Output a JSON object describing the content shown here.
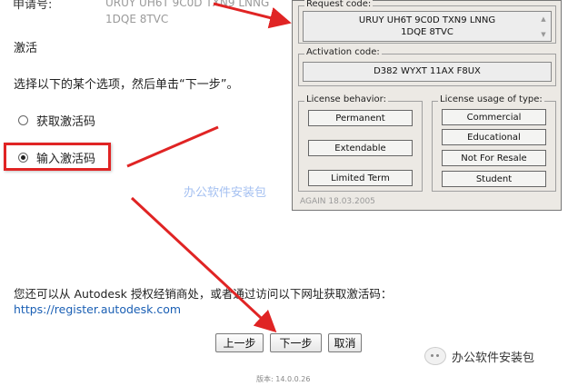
{
  "installer": {
    "request_label": "申请号:",
    "request_value_line1": "URUY UH6T 9C0D TXN9 LNNG",
    "request_value_line2": "1DQE 8TVC",
    "section_title": "激活",
    "instruction": "选择以下的某个选项，然后单击“下一步”。",
    "option_get_code": "获取激活码",
    "option_enter_code": "输入激活码",
    "footer_text": "您还可以从 Autodesk 授权经销商处，或者通过访问以下网址获取激活码：",
    "footer_link": "https://register.autodesk.com",
    "back_button": "上一步",
    "next_button": "下一步",
    "cancel_button": "取消",
    "version": "版本: 14.0.0.26"
  },
  "keygen": {
    "request_code_label": "Request code:",
    "request_code_line1": "URUY UH6T 9C0D TXN9 LNNG",
    "request_code_line2": "1DQE 8TVC",
    "activation_code_label": "Activation code:",
    "activation_code_value": "D382 WYXT 11AX F8UX",
    "license_behavior_label": "License behavior:",
    "behavior_buttons": [
      "Permanent",
      "Extendable",
      "Limited Term"
    ],
    "license_usage_label": "License usage of type:",
    "usage_buttons": [
      "Commercial",
      "Educational",
      "Not For Resale",
      "Student"
    ],
    "footer": "AGAIN 18.03.2005"
  },
  "watermark": "办公软件安装包",
  "wechat_account": "办公软件安装包",
  "colors": {
    "highlight": "#e02424",
    "arrow": "#e02424",
    "link": "#1a5fb4"
  }
}
